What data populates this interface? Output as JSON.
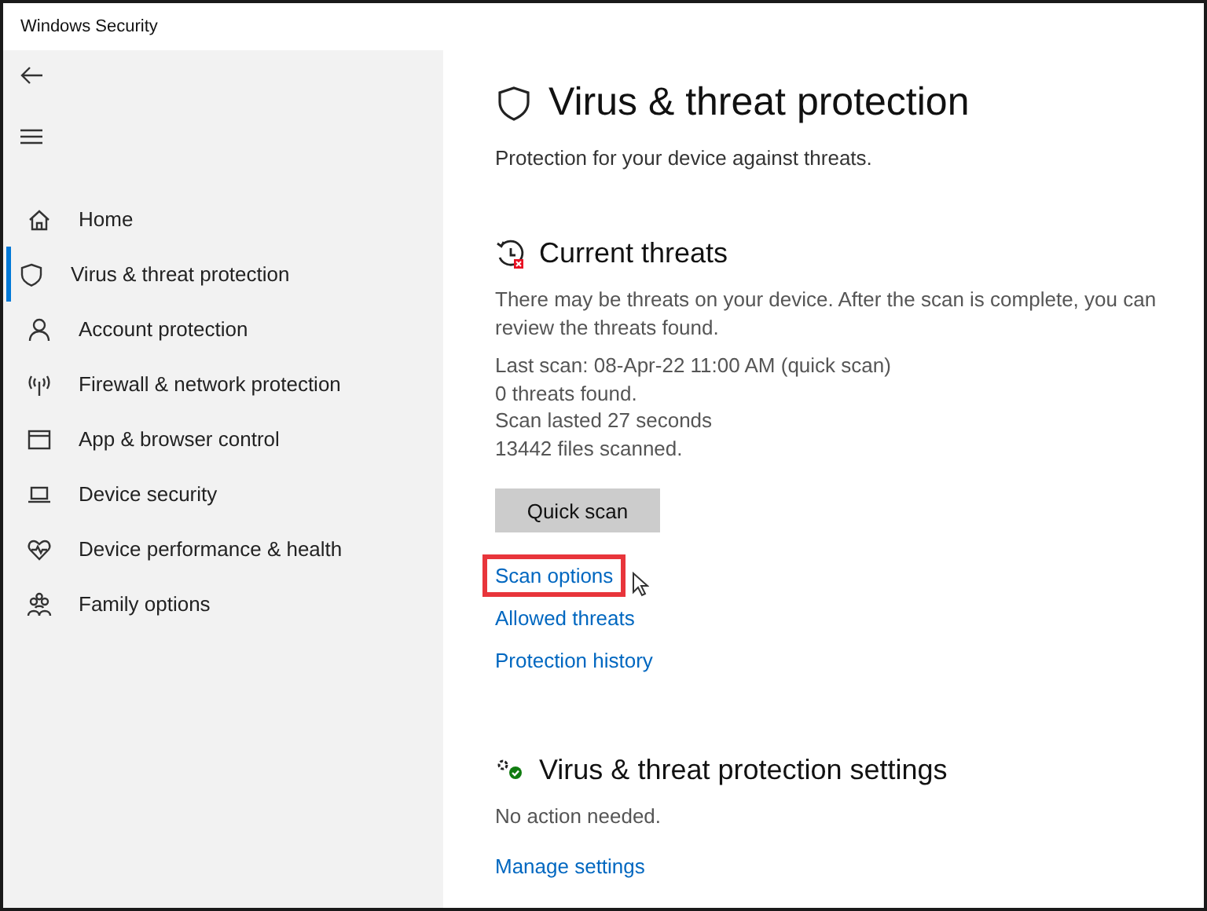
{
  "window": {
    "title": "Windows Security"
  },
  "sidebar": {
    "items": [
      {
        "label": "Home",
        "selected": false
      },
      {
        "label": "Virus & threat protection",
        "selected": true
      },
      {
        "label": "Account protection",
        "selected": false
      },
      {
        "label": "Firewall & network protection",
        "selected": false
      },
      {
        "label": "App & browser control",
        "selected": false
      },
      {
        "label": "Device security",
        "selected": false
      },
      {
        "label": "Device performance & health",
        "selected": false
      },
      {
        "label": "Family options",
        "selected": false
      }
    ]
  },
  "page": {
    "title": "Virus & threat protection",
    "subtitle": "Protection for your device against threats."
  },
  "current_threats": {
    "heading": "Current threats",
    "description": "There may be threats on your device. After the scan is complete, you can review the threats found.",
    "scan_info": [
      "Last scan: 08-Apr-22 11:00 AM (quick scan)",
      "0 threats found.",
      "Scan lasted 27 seconds",
      "13442 files scanned."
    ],
    "button": "Quick scan",
    "links": [
      {
        "label": "Scan options",
        "highlighted": true
      },
      {
        "label": "Allowed threats",
        "highlighted": false
      },
      {
        "label": "Protection history",
        "highlighted": false
      }
    ]
  },
  "settings": {
    "heading": "Virus & threat protection settings",
    "status": "No action needed.",
    "link": "Manage settings"
  }
}
